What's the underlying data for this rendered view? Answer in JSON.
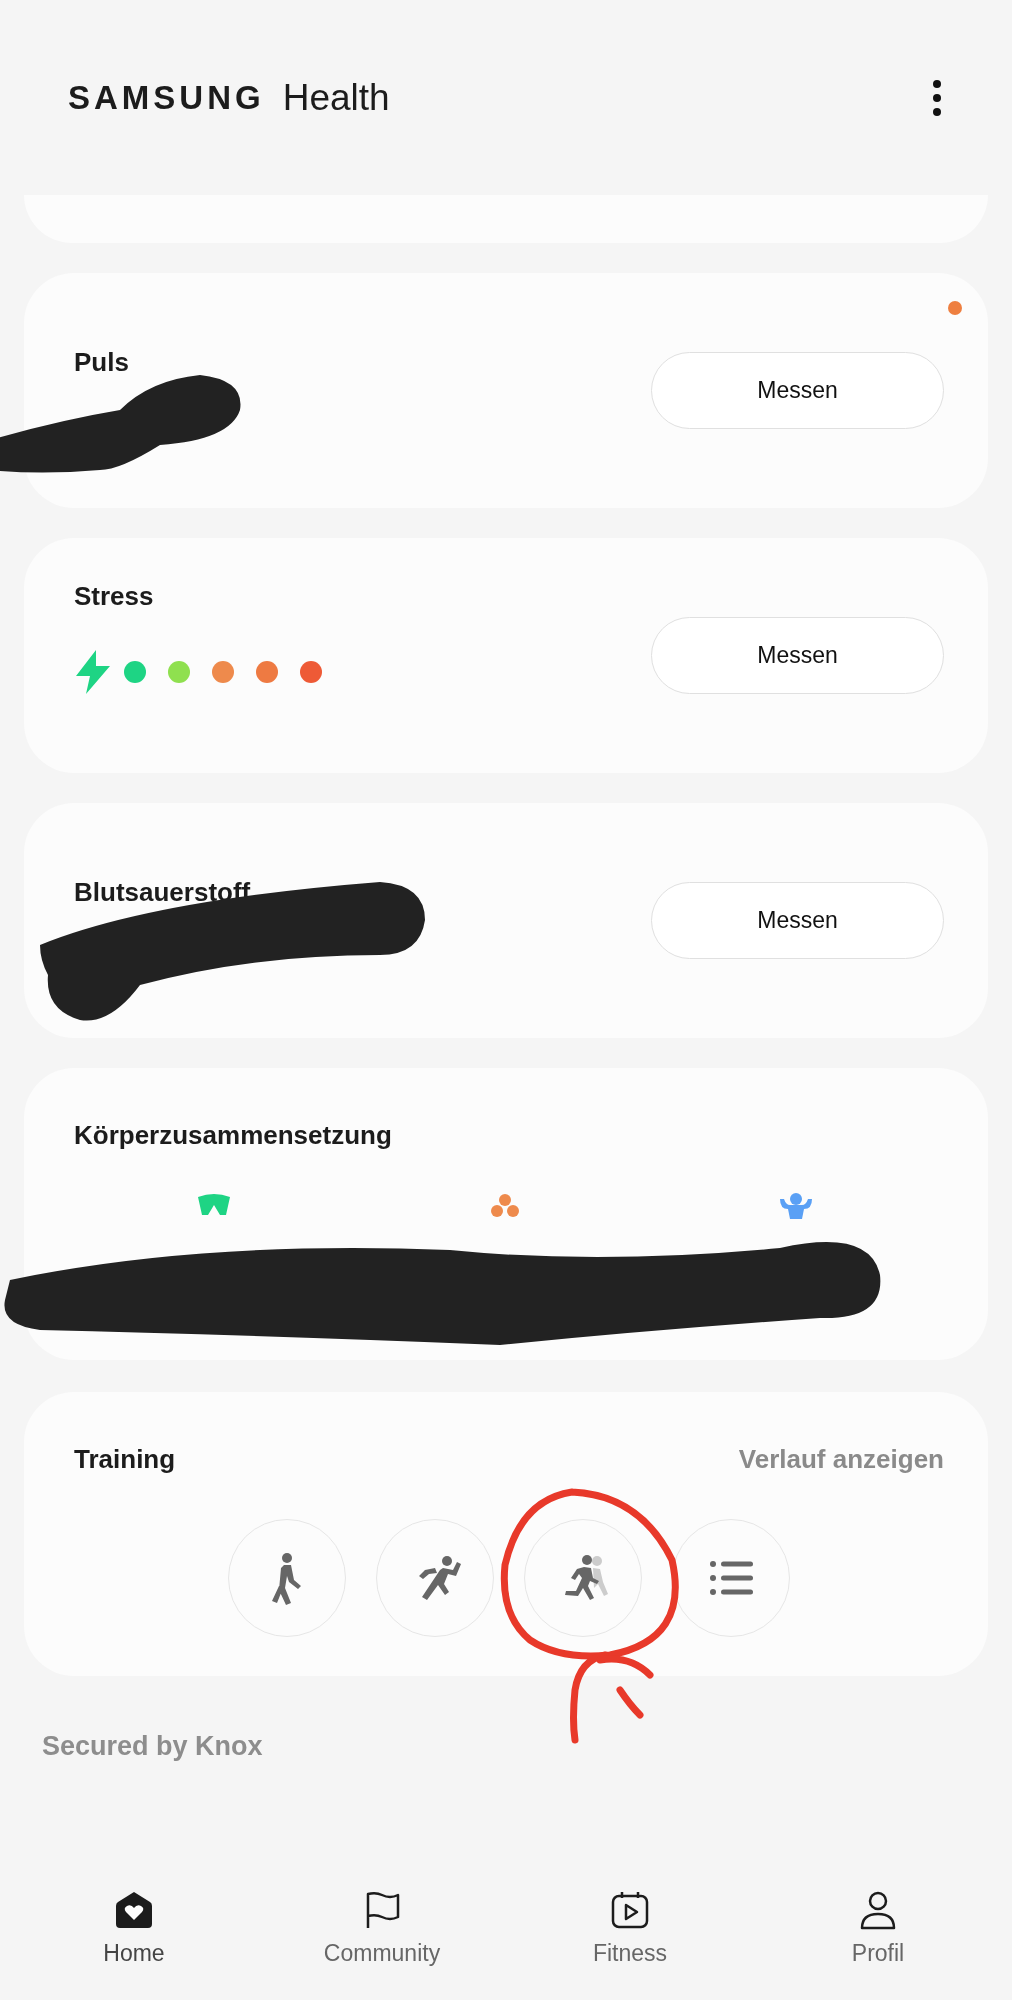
{
  "header": {
    "brand": "SAMSUNG",
    "app": "Health"
  },
  "cards": [
    {
      "kind": "measure",
      "title": "Puls",
      "button": "Messen",
      "unread": true
    },
    {
      "kind": "stress",
      "title": "Stress",
      "button": "Messen",
      "unread": false,
      "scale": [
        {
          "color": "#1ed484"
        },
        {
          "color": "#8fe04f"
        },
        {
          "color": "#ee8a4c"
        },
        {
          "color": "#ee7a42"
        },
        {
          "color": "#ee5a36"
        }
      ]
    },
    {
      "kind": "measure",
      "title": "Blutsauerstoff",
      "button": "Messen",
      "unread": false
    },
    {
      "kind": "body",
      "title": "Körperzusammensetzung"
    },
    {
      "kind": "training",
      "title": "Training",
      "link": "Verlauf anzeigen",
      "buttons": [
        {
          "kind": "walk"
        },
        {
          "kind": "sprint"
        },
        {
          "kind": "run"
        },
        {
          "kind": "list"
        }
      ]
    }
  ],
  "footer_note": "Secured by Knox",
  "nav": [
    {
      "kind": "home",
      "label": "Home",
      "selected": true
    },
    {
      "kind": "community",
      "label": "Community",
      "selected": false
    },
    {
      "kind": "fitness",
      "label": "Fitness",
      "selected": false
    },
    {
      "kind": "profile",
      "label": "Profil",
      "selected": false
    }
  ]
}
